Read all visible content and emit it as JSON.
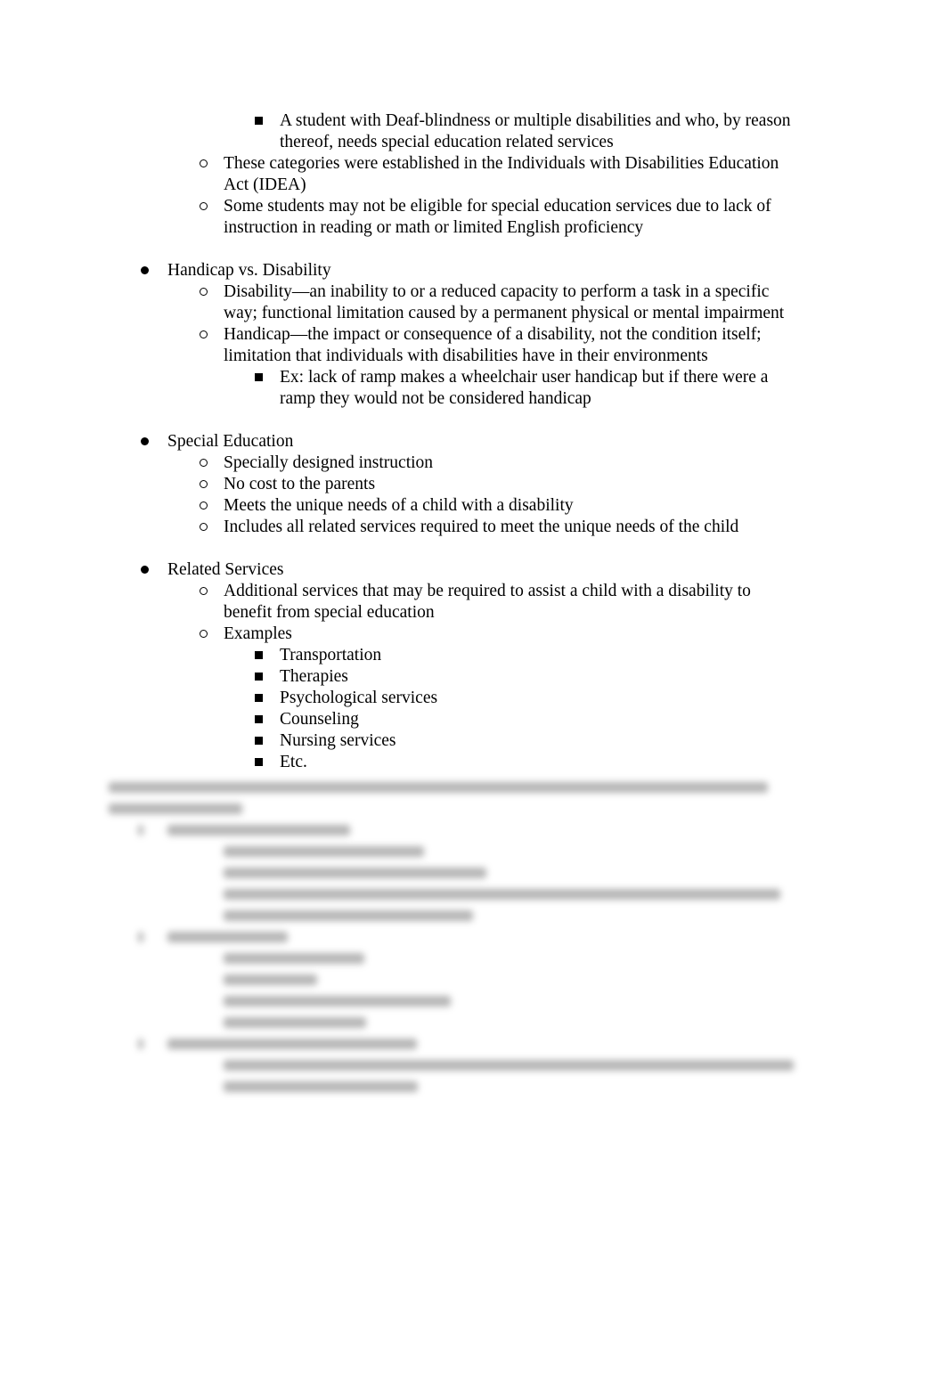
{
  "document": {
    "continuation": {
      "sub_sub_item": "A student with Deaf-blindness or multiple disabilities and who, by reason",
      "sub_sub_item_cont": "thereof, needs special education related services",
      "sub_items": [
        {
          "l1": "These categories were established in the Individuals with Disabilities Education",
          "l2": "Act (IDEA)"
        },
        {
          "l1": "Some students may not be eligible for special education services due to lack of",
          "l2": "instruction in reading or math or limited English proficiency"
        }
      ]
    },
    "sections": [
      {
        "title": "Handicap vs. Disability",
        "items": [
          {
            "l1": "Disability—an inability to or a reduced capacity to perform a task in a specific",
            "l2": "way; functional limitation caused by a permanent physical or mental impairment"
          },
          {
            "l1": "Handicap—the impact or consequence of a disability, not the condition itself;",
            "l2": "limitation that individuals with disabilities have in their environments",
            "sub": {
              "l1": "Ex: lack of ramp makes a wheelchair user handicap but if there were a",
              "l2": "ramp they would not be considered handicap"
            }
          }
        ]
      },
      {
        "title": "Special Education",
        "items": [
          "Specially designed instruction",
          "No cost to the parents",
          "Meets the unique needs of a child with a disability",
          "Includes all related services required to meet the unique needs of the child"
        ]
      },
      {
        "title": "Related Services",
        "items": [
          {
            "l1": "Additional services that may be required to assist a child with a disability to",
            "l2": "benefit from special education"
          },
          {
            "l1": "Examples"
          }
        ],
        "examples": [
          "Transportation",
          "Therapies",
          "Psychological services",
          "Counseling",
          "Nursing services",
          "Etc."
        ]
      }
    ]
  }
}
